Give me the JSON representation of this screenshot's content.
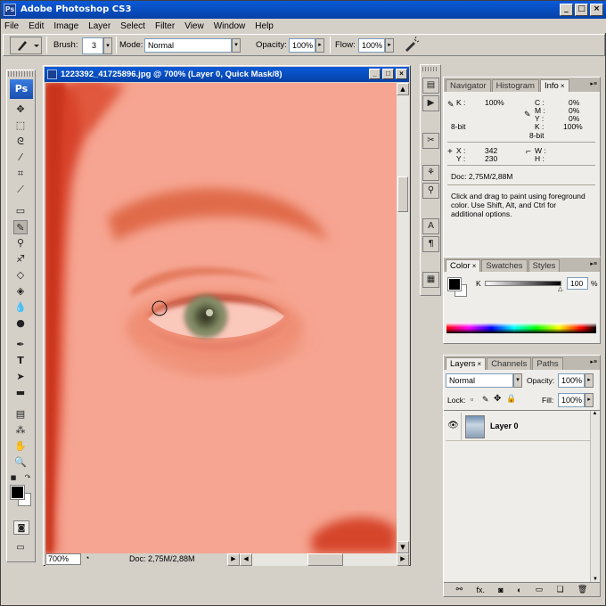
{
  "app": {
    "title": "Adobe Photoshop CS3",
    "ps_logo": "Ps"
  },
  "menu": [
    "File",
    "Edit",
    "Image",
    "Layer",
    "Select",
    "Filter",
    "View",
    "Window",
    "Help"
  ],
  "options": {
    "brush_label": "Brush:",
    "brush_size": "3",
    "mode_label": "Mode:",
    "mode_value": "Normal",
    "opacity_label": "Opacity:",
    "opacity_value": "100%",
    "flow_label": "Flow:",
    "flow_value": "100%"
  },
  "document": {
    "title": "1223392_41725896.jpg @ 700% (Layer 0, Quick Mask/8)",
    "zoom": "700%",
    "doc_size": "Doc: 2,75M/2,88M"
  },
  "navigator_panel": {
    "tabs": [
      "Navigator",
      "Histogram",
      "Info"
    ],
    "active_tab": "Info",
    "info": {
      "k_label": "K :",
      "k_value": "100%",
      "bit1": "8-bit",
      "c_label": "C :",
      "c_value": "0%",
      "m_label": "M :",
      "m_value": "0%",
      "y_label": "Y :",
      "y_value": "0%",
      "k2_label": "K :",
      "k2_value": "100%",
      "bit2": "8-bit",
      "x_label": "X :",
      "x_value": "342",
      "y2_label": "Y :",
      "y2_value": "230",
      "w_label": "W :",
      "h_label": "H :",
      "doc": "Doc: 2,75M/2,88M",
      "hint": [
        "Click and drag to paint using foreground",
        "color.  Use Shift, Alt, and Ctrl for",
        "additional options."
      ]
    }
  },
  "color_panel": {
    "tabs": [
      "Color",
      "Swatches",
      "Styles"
    ],
    "active_tab": "Color",
    "k_label": "K",
    "k_value": "100",
    "unit": "%"
  },
  "layers_panel": {
    "tabs": [
      "Layers",
      "Channels",
      "Paths"
    ],
    "active_tab": "Layers",
    "blend_mode": "Normal",
    "opacity_label": "Opacity:",
    "opacity_value": "100%",
    "lock_label": "Lock:",
    "fill_label": "Fill:",
    "fill_value": "100%",
    "layers": [
      {
        "name": "Layer 0",
        "visible": true
      }
    ],
    "footer_icons": [
      "link-icon",
      "fx-icon",
      "mask-icon",
      "adjustment-icon",
      "group-icon",
      "new-layer-icon",
      "trash-icon"
    ],
    "fx_label": "fx."
  },
  "colors": {
    "title_bar": "#0a5ad8",
    "quick_mask": "#f6a592",
    "foreground": "#000000",
    "background": "#ffffff"
  }
}
